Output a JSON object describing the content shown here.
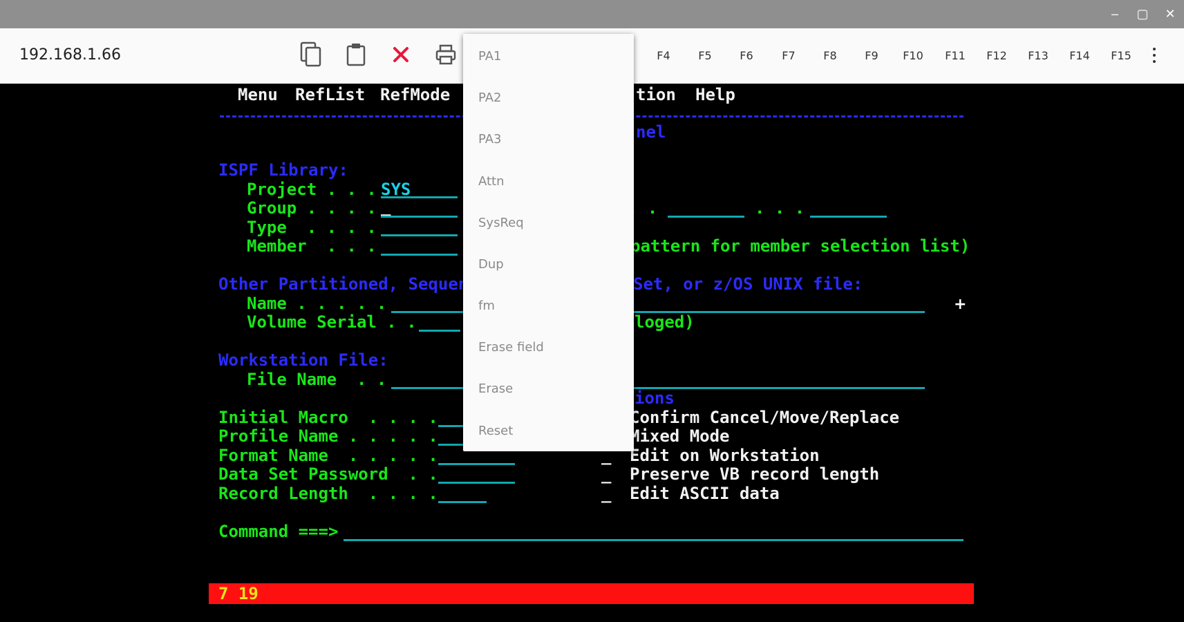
{
  "titlebar": {
    "minimize": "–",
    "restore": "▢",
    "close": "✕"
  },
  "toolbar": {
    "host": "192.168.1.66",
    "icons": [
      "copy-icon",
      "paste-icon",
      "disconnect-icon",
      "print-icon"
    ],
    "fkeys": [
      "F4",
      "F5",
      "F6",
      "F7",
      "F8",
      "F9",
      "F10",
      "F11",
      "F12",
      "F13",
      "F14",
      "F15"
    ],
    "accent_color": "#e8173a"
  },
  "dropdown": {
    "items": [
      "PA1",
      "PA2",
      "PA3",
      "Attn",
      "SysReq",
      "Dup",
      "fm",
      "Erase field",
      "Erase",
      "Reset"
    ]
  },
  "terminal": {
    "menubar": {
      "menu": "Menu",
      "reflist": "RefList",
      "refmode": "RefMode",
      "partial": "tion",
      "help": "Help"
    },
    "panel_title_partial": "nel",
    "ispf_library": "ISPF Library:",
    "project_label": "Project . . .",
    "project_value": "SYS",
    "group_label": "Group . . . .",
    "group_cursor": "_",
    "group_dots": ". .",
    "group_dots2": ". . .",
    "type_label": "Type  . . . .",
    "member_label": "Member  . . .",
    "member_hint": "pattern for member selection list)",
    "other_heading_left": "Other Partitioned, Sequent",
    "other_heading_right": "Set, or z/OS UNIX file:",
    "name_label": "Name . . . . .",
    "volume_label": "Volume Serial . .",
    "volume_hint": "loged)",
    "workstation_heading": "Workstation File:",
    "filename_label": "File Name  . .",
    "options_partial": "ions",
    "initial_macro": "Initial Macro  . . . .",
    "profile_name": "Profile Name . . . . .",
    "format_name": "Format Name  . . . . .",
    "data_set_password": "Data Set Password  . .",
    "record_length": "Record Length  . . . .",
    "opt_underscore": "_",
    "opt1": "Confirm Cancel/Move/Replace",
    "opt2": "Mixed Mode",
    "opt3": "Edit on Workstation",
    "opt4": "Preserve VB record length",
    "opt5": "Edit ASCII data",
    "command_label": "Command ===>",
    "status": "7 19",
    "cursor_glyph": "+"
  },
  "colors": {
    "terminal_green": "#19e619",
    "terminal_blue": "#2b2bff",
    "terminal_turquoise": "#19d2e6",
    "status_red": "#ff1010",
    "status_yellow": "#e6e619"
  }
}
